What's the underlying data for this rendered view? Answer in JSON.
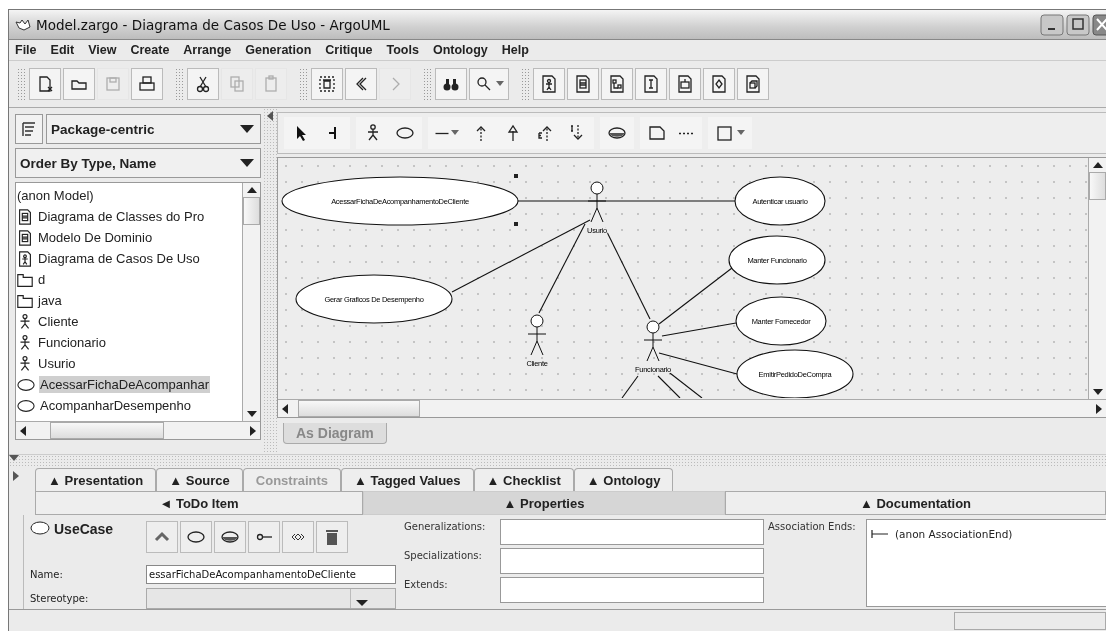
{
  "window": {
    "title": "Model.zargo - Diagrama de Casos De Uso - ArgoUML"
  },
  "menu": [
    "File",
    "Edit",
    "View",
    "Create",
    "Arrange",
    "Generation",
    "Critique",
    "Tools",
    "Ontology",
    "Help"
  ],
  "toolbar": [
    {
      "disabled": false
    },
    {
      "disabled": false
    },
    {
      "disabled": true
    },
    {
      "disabled": false
    },
    {
      "disabled": false
    },
    {
      "disabled": true
    },
    {
      "disabled": true
    },
    {
      "disabled": false
    },
    {
      "disabled": false
    },
    {
      "disabled": true
    },
    {
      "disabled": false
    },
    {
      "disabled": false
    },
    {
      "disabled": false
    },
    {
      "disabled": false
    },
    {
      "disabled": false
    },
    {
      "disabled": false
    },
    {
      "disabled": false
    },
    {
      "disabled": false
    },
    {
      "disabled": false
    }
  ],
  "explorer": {
    "perspective": "Package-centric",
    "order": "Order By Type, Name",
    "items": [
      {
        "kind": "model",
        "label": "(anon Model)",
        "selected": false
      },
      {
        "kind": "class-diagram",
        "label": "Diagrama de Classes do Pro",
        "selected": false
      },
      {
        "kind": "class-diagram",
        "label": "Modelo De Dominio",
        "selected": false
      },
      {
        "kind": "usecase-diagram",
        "label": "Diagrama de Casos De Uso",
        "selected": false
      },
      {
        "kind": "package",
        "label": "d",
        "selected": false
      },
      {
        "kind": "package",
        "label": "java",
        "selected": false
      },
      {
        "kind": "actor",
        "label": "Cliente",
        "selected": false
      },
      {
        "kind": "actor",
        "label": "Funcionario",
        "selected": false
      },
      {
        "kind": "actor",
        "label": "Usurio",
        "selected": false
      },
      {
        "kind": "usecase",
        "label": "AcessarFichaDeAcompanhar",
        "selected": true
      },
      {
        "kind": "usecase",
        "label": "AcompanharDesempenho",
        "selected": false
      }
    ]
  },
  "diagram": {
    "use_cases": [
      {
        "name": "AcessarFichaDeAcompanhamentoDeCliente"
      },
      {
        "name": "Autenticar usuario"
      },
      {
        "name": "Gerar Graficos De Desempenho"
      },
      {
        "name": "Manter Funcionario"
      },
      {
        "name": "Manter Fornecedor"
      },
      {
        "name": "EmitirPedidoDeCompra"
      }
    ],
    "actors": [
      {
        "name": "Usurio"
      },
      {
        "name": "Cliente"
      },
      {
        "name": "Funcionario"
      }
    ],
    "tab": "As Diagram"
  },
  "details": {
    "tabs": [
      {
        "label": "▲ Presentation",
        "disabled": false
      },
      {
        "label": "▲ Source",
        "disabled": false
      },
      {
        "label": "Constraints",
        "disabled": true
      },
      {
        "label": "▲ Tagged Values",
        "disabled": false
      },
      {
        "label": "▲ Checklist",
        "disabled": false
      },
      {
        "label": "▲ Ontology",
        "disabled": false
      }
    ],
    "subtabs": [
      {
        "label": "◄ ToDo Item",
        "selected": false
      },
      {
        "label": "▲ Properties",
        "selected": true
      },
      {
        "label": "▲ Documentation",
        "selected": false
      }
    ],
    "properties": {
      "type": "UseCase",
      "name_label": "Name:",
      "name_value": "essarFichaDeAcompanhamentoDeCliente",
      "stereotype_label": "Stereotype:",
      "fields": [
        {
          "label": "Generalizations:"
        },
        {
          "label": "Specializations:"
        },
        {
          "label": "Extends:"
        }
      ],
      "association_ends_label": "Association Ends:",
      "association_ends": [
        "(anon AssociationEnd)"
      ]
    }
  }
}
